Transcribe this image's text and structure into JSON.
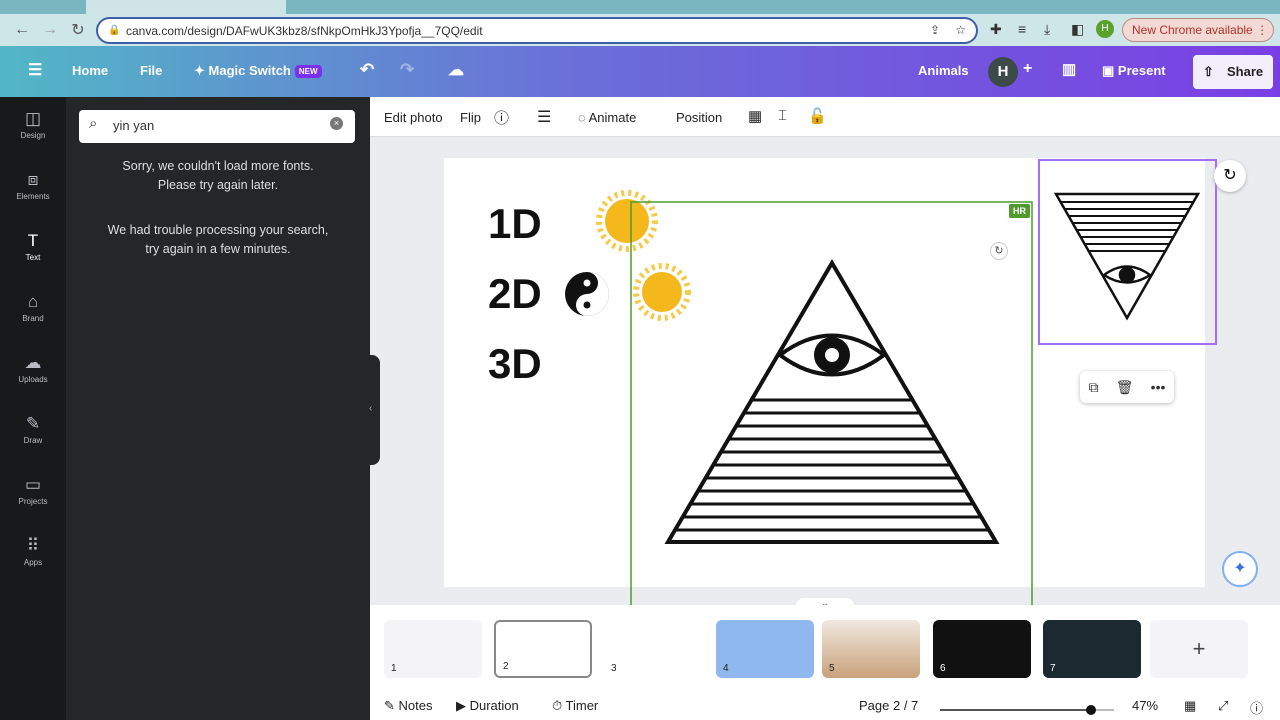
{
  "browser": {
    "url": "canva.com/design/DAFwUK3kbz8/sfNkpOmHkJ3Ypofja__7QQ/edit",
    "profile_initial": "H",
    "new_chrome": "New Chrome available"
  },
  "header": {
    "home": "Home",
    "file": "File",
    "magic_switch": "Magic Switch",
    "new_badge": "NEW",
    "design_name": "Animals",
    "avatar_initial": "H",
    "present": "Present",
    "share": "Share",
    "accent": "#7a3fe4"
  },
  "rail": [
    {
      "label": "Design",
      "icon": "layout-icon"
    },
    {
      "label": "Elements",
      "icon": "shapes-icon"
    },
    {
      "label": "Text",
      "icon": "text-icon"
    },
    {
      "label": "Brand",
      "icon": "brand-icon"
    },
    {
      "label": "Uploads",
      "icon": "cloud-upload-icon"
    },
    {
      "label": "Draw",
      "icon": "pen-icon"
    },
    {
      "label": "Projects",
      "icon": "folder-icon"
    },
    {
      "label": "Apps",
      "icon": "grid-icon"
    }
  ],
  "panel": {
    "search_value": "yin yan",
    "msg1a": "Sorry, we couldn't load more fonts.",
    "msg1b": "Please try again later.",
    "msg2a": "We had trouble processing your search,",
    "msg2b": "try again in a few minutes."
  },
  "toolbar": {
    "edit_photo": "Edit photo",
    "flip": "Flip",
    "animate": "Animate",
    "position": "Position"
  },
  "canvas": {
    "label_1d": "1D",
    "label_2d": "2D",
    "label_3d": "3D",
    "hr_badge": "HR"
  },
  "thumbnails": [
    {
      "num": "1"
    },
    {
      "num": "2"
    },
    {
      "num": "3"
    },
    {
      "num": "4"
    },
    {
      "num": "5"
    },
    {
      "num": "6"
    },
    {
      "num": "7"
    }
  ],
  "footer": {
    "notes": "Notes",
    "duration": "Duration",
    "timer": "Timer",
    "page": "Page 2 / 7",
    "zoom": "47%",
    "zoom_percent": 47
  }
}
